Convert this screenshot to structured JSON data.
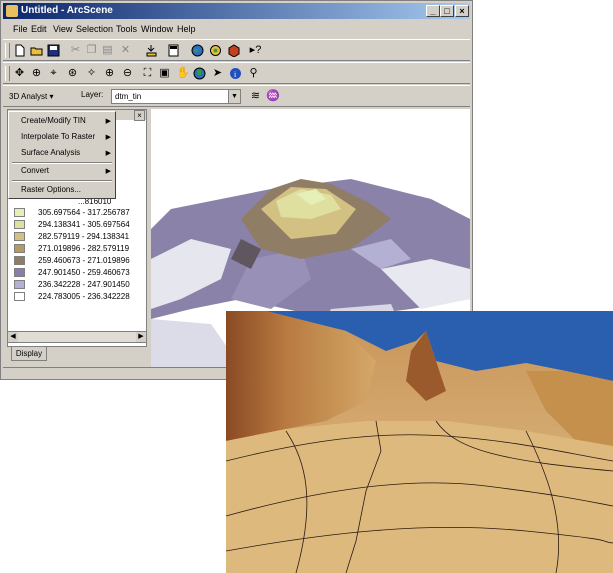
{
  "window": {
    "title": "Untitled - ArcScene",
    "controls": {
      "minimize": "_",
      "maximize": "□",
      "close": "×"
    }
  },
  "menubar": [
    "File",
    "Edit",
    "View",
    "Selection",
    "Tools",
    "Window",
    "Help"
  ],
  "toolbar3d": {
    "analyst_label": "3D Analyst ▾",
    "layer_label": "Layer:",
    "layer_value": "dtm_tin"
  },
  "context_menu": {
    "items": [
      {
        "label": "Create/Modify TIN",
        "submenu": true
      },
      {
        "label": "Interpolate To Raster",
        "submenu": true
      },
      {
        "label": "Surface Analysis",
        "submenu": true
      },
      {
        "label": "Convert",
        "submenu": true
      },
      {
        "label": "Raster Options...",
        "submenu": false
      }
    ],
    "submenu_arrow": "▶"
  },
  "legend": {
    "partial_top": "...816010",
    "rows": [
      {
        "label": "305.697564 - 317.256787",
        "color": "#e6efb8"
      },
      {
        "label": "294.138341 - 305.697564",
        "color": "#dfe0a0"
      },
      {
        "label": "282.579119 - 294.138341",
        "color": "#d3c184"
      },
      {
        "label": "271.019896 - 282.579119",
        "color": "#b39a66"
      },
      {
        "label": "259.460673 - 271.019896",
        "color": "#8f7d66"
      },
      {
        "label": "247.901450 - 259.460673",
        "color": "#8a7fa8"
      },
      {
        "label": "236.342228 - 247.901450",
        "color": "#b4b0d4"
      },
      {
        "label": "224.783005 - 236.342228",
        "color": "#ffffff"
      }
    ]
  },
  "toc": {
    "close": "×",
    "tab": "Display"
  },
  "scroll": {
    "left": "◀",
    "right": "▶"
  },
  "icons": {
    "toolbar1": [
      "new-doc",
      "open-folder",
      "save",
      "cut",
      "copy",
      "paste",
      "delete",
      "add-data",
      "properties",
      "globe",
      "animation",
      "tin-cube",
      "whats-this"
    ],
    "toolbar2": [
      "navigate",
      "fly",
      "target",
      "zoom-to-target",
      "center-on-target",
      "zoom-in",
      "zoom-out",
      "full-extent",
      "fixed-extent",
      "pan",
      "globe-nav",
      "select",
      "identify",
      "find"
    ]
  }
}
